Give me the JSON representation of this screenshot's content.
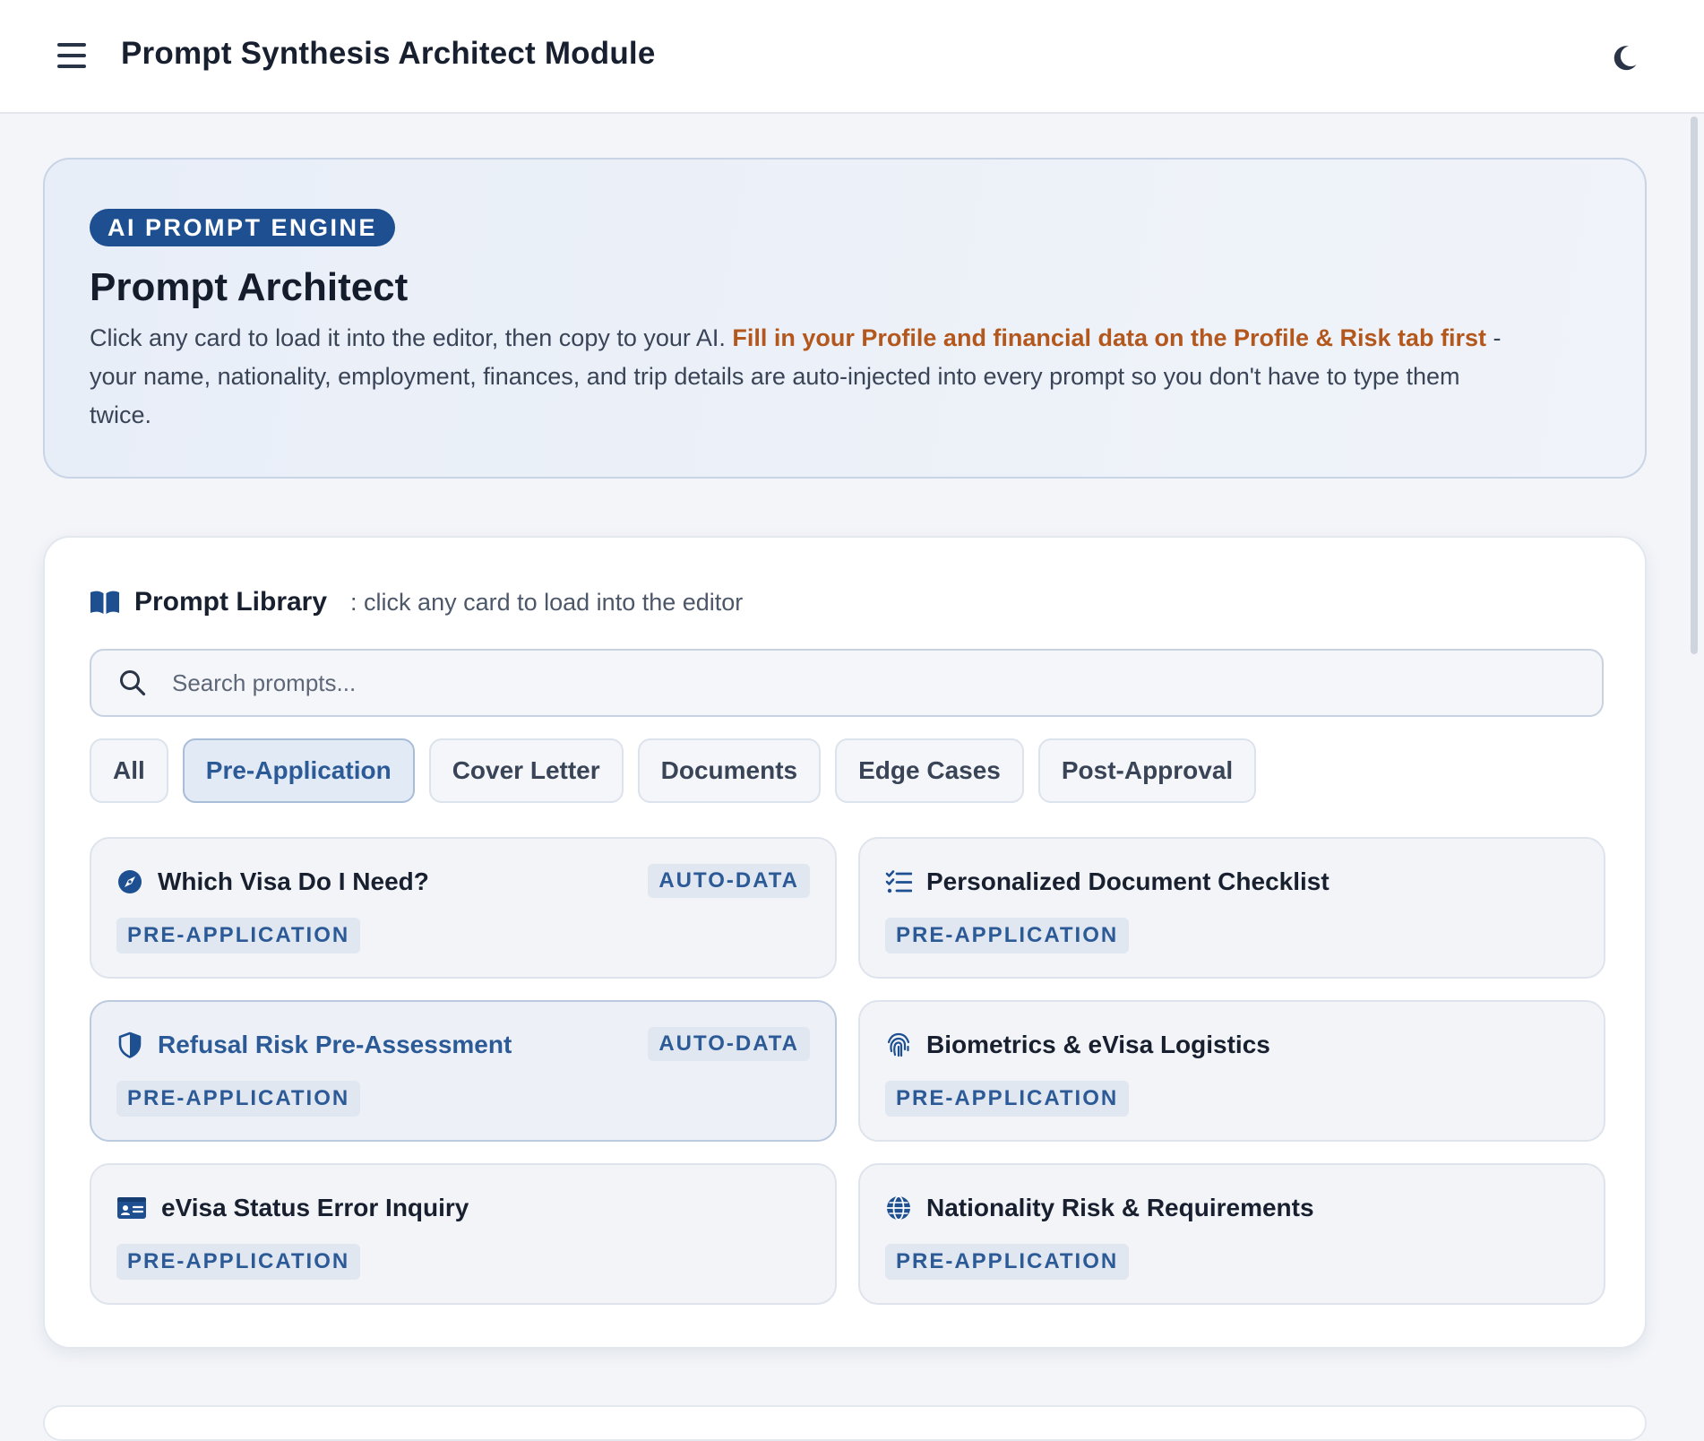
{
  "app": {
    "title": "Prompt Synthesis Architect Module"
  },
  "hero": {
    "badge": "AI PROMPT ENGINE",
    "title": "Prompt Architect",
    "desc_before": "Click any card to load it into the editor, then copy to your AI. ",
    "desc_highlight": "Fill in your Profile and financial data on the Profile & Risk tab first",
    "desc_after": " - your name, nationality, employment, finances, and trip details are auto-injected into every prompt so you don't have to type them twice."
  },
  "library": {
    "title": "Prompt Library",
    "subtitle": ": click any card to load into the editor",
    "search_placeholder": "Search prompts...",
    "tabs": [
      {
        "label": "All"
      },
      {
        "label": "Pre-Application",
        "active": true
      },
      {
        "label": "Cover Letter"
      },
      {
        "label": "Documents"
      },
      {
        "label": "Edge Cases"
      },
      {
        "label": "Post-Approval"
      }
    ],
    "cards": [
      {
        "title": "Which Visa Do I Need?",
        "tag": "PRE-APPLICATION",
        "badge": "AUTO-DATA",
        "icon": "compass-icon"
      },
      {
        "title": "Personalized Document Checklist",
        "tag": "PRE-APPLICATION",
        "badge": "",
        "icon": "checklist-icon"
      },
      {
        "title": "Refusal Risk Pre-Assessment",
        "tag": "PRE-APPLICATION",
        "badge": "AUTO-DATA",
        "icon": "shield-icon",
        "selected": true
      },
      {
        "title": "Biometrics & eVisa Logistics",
        "tag": "PRE-APPLICATION",
        "badge": "",
        "icon": "fingerprint-icon"
      },
      {
        "title": "eVisa Status Error Inquiry",
        "tag": "PRE-APPLICATION",
        "badge": "",
        "icon": "id-card-icon"
      },
      {
        "title": "Nationality Risk & Requirements",
        "tag": "PRE-APPLICATION",
        "badge": "",
        "icon": "globe-icon"
      }
    ]
  },
  "colors": {
    "accent": "#2b5a97",
    "badge_bg": "#1e4f91",
    "highlight": "#b3571c"
  }
}
